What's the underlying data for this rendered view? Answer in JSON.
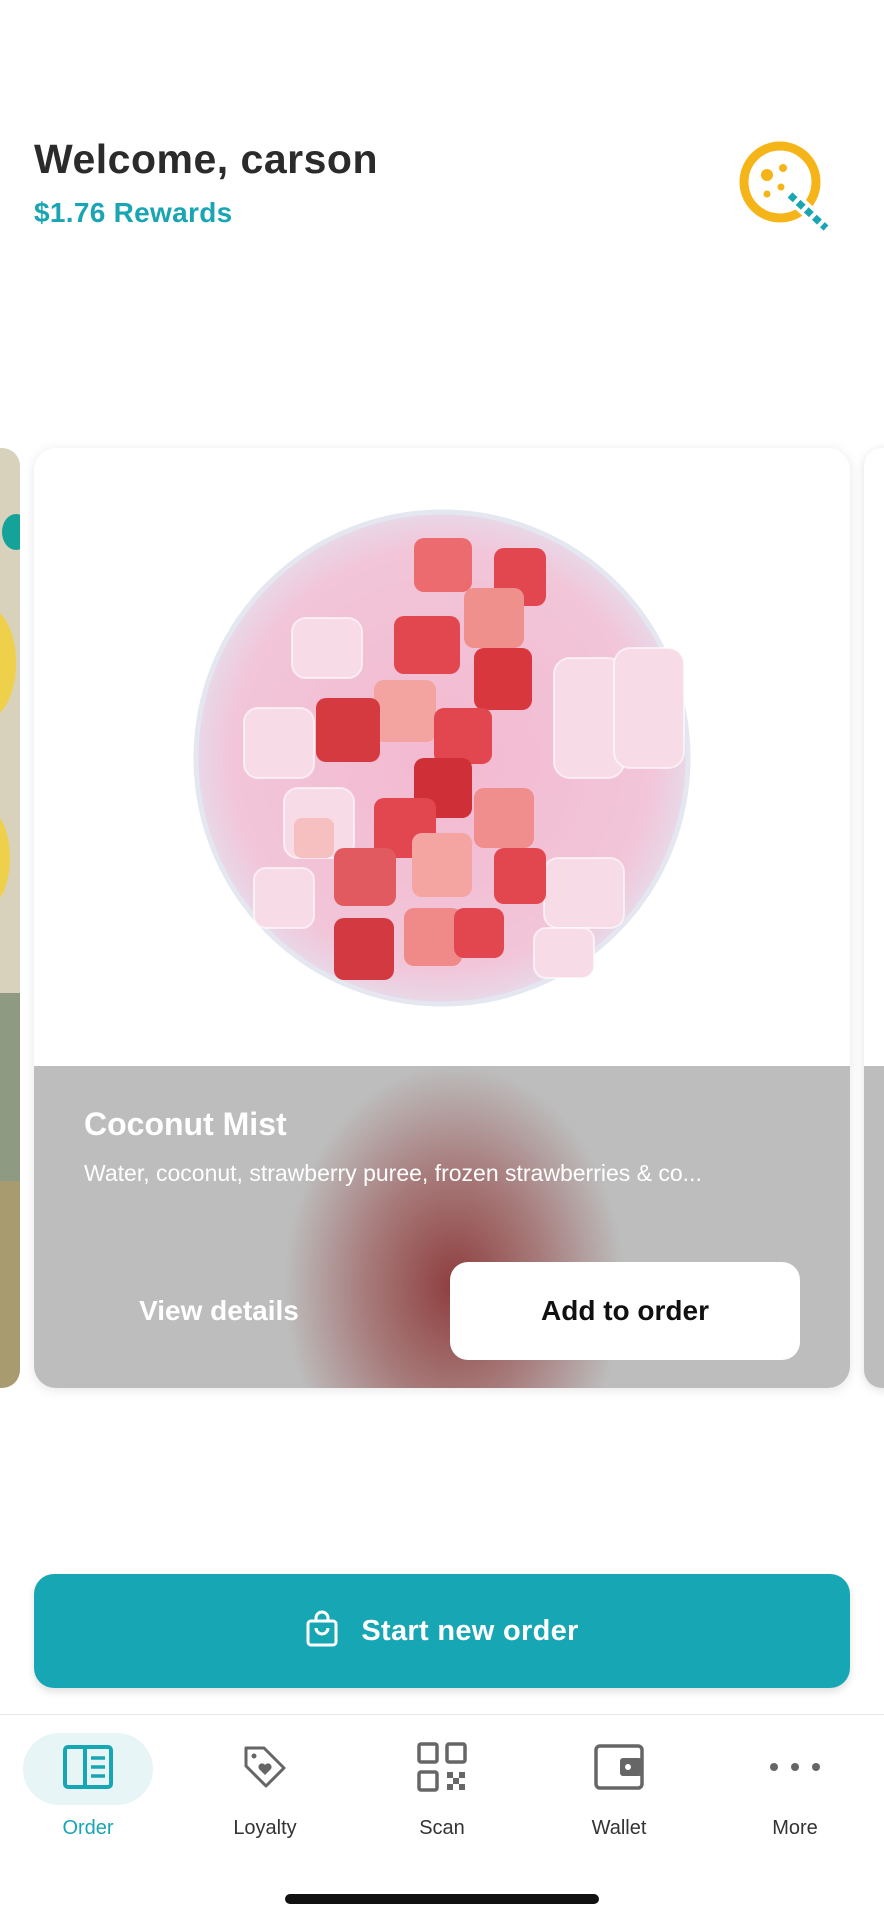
{
  "header": {
    "welcome": "Welcome, carson",
    "rewards": "$1.76 Rewards",
    "logo_icon": "boba-logo-icon"
  },
  "card": {
    "name": "Coconut Mist",
    "description": "Water, coconut, strawberry puree, frozen strawberries & co...",
    "view_details": "View details",
    "add_to_order": "Add to order"
  },
  "start_order": {
    "label": "Start new order",
    "icon": "shopping-bag-icon"
  },
  "tabs": [
    {
      "label": "Order",
      "icon": "menu-book-icon",
      "active": true
    },
    {
      "label": "Loyalty",
      "icon": "tag-heart-icon",
      "active": false
    },
    {
      "label": "Scan",
      "icon": "qr-code-icon",
      "active": false
    },
    {
      "label": "Wallet",
      "icon": "wallet-icon",
      "active": false
    },
    {
      "label": "More",
      "icon": "more-dots-icon",
      "active": false
    }
  ],
  "colors": {
    "accent": "#17a6b4",
    "logo": "#f5b417"
  }
}
